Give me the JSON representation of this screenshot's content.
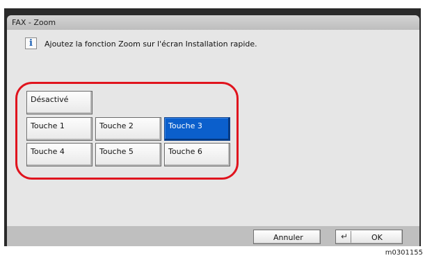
{
  "dialog": {
    "title": "FAX - Zoom",
    "message": "Ajoutez la fonction Zoom sur l'écran Installation rapide.",
    "info_icon": "info-icon",
    "info_glyph": "i"
  },
  "options": {
    "off": "Désactivé",
    "keys": [
      "Touche 1",
      "Touche 2",
      "Touche 3",
      "Touche 4",
      "Touche 5",
      "Touche 6"
    ],
    "selected": "Touche 3"
  },
  "footer": {
    "cancel_label": "Annuler",
    "ok_label": "OK",
    "ok_icon": "enter-icon"
  },
  "figure_id": "m0301155",
  "colors": {
    "selected": "#0b5fcc",
    "highlight_frame": "#e0141e"
  }
}
